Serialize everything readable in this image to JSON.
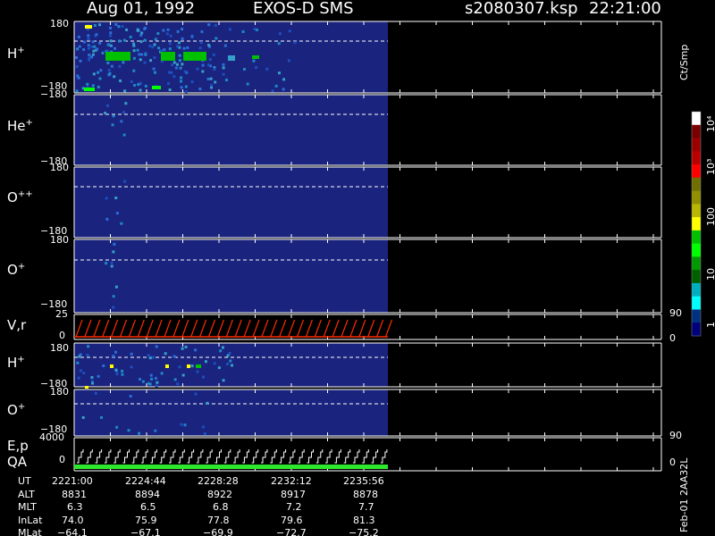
{
  "header": {
    "date": "Aug 01, 1992",
    "instrument": "EXOS-D SMS",
    "file": "s2080307.ksp",
    "time": "22:21:00"
  },
  "panels": [
    {
      "id": "h-plus",
      "species": "H",
      "charge": "+",
      "ymax": "180",
      "ymin": "−180"
    },
    {
      "id": "he-plus",
      "species": "He",
      "charge": "+",
      "ymax": "180",
      "ymin": "−180"
    },
    {
      "id": "o-plus-plus",
      "species": "O",
      "charge": "++",
      "ymax": "180",
      "ymin": "−180"
    },
    {
      "id": "o-plus",
      "species": "O",
      "charge": "+",
      "ymax": "180",
      "ymin": "−180"
    },
    {
      "id": "v-r",
      "species": "V,r",
      "charge": "",
      "ymax": "25",
      "ymin": "0",
      "right_max": "90",
      "right_min": "0"
    },
    {
      "id": "h-plus-2",
      "species": "H",
      "charge": "+",
      "ymax": "180",
      "ymin": "−180"
    },
    {
      "id": "o-plus-2",
      "species": "O",
      "charge": "+",
      "ymax": "180",
      "ymin": "−180"
    },
    {
      "id": "e-p-qa",
      "species": "E,p",
      "species2": "QA",
      "charge": "",
      "ymax": "4000",
      "ymin": "0",
      "right_max": "90",
      "right_min": "0"
    }
  ],
  "colorbar": {
    "title": "Ct/Smp",
    "labels": [
      "10⁴",
      "10³",
      "100",
      "10",
      "1"
    ],
    "colors": [
      "#ffffff",
      "#7a0000",
      "#9a0000",
      "#bb0000",
      "#ff0000",
      "#707000",
      "#909000",
      "#b8b800",
      "#ffff00",
      "#00c000",
      "#00ff00",
      "#009900",
      "#006000",
      "#00b0c0",
      "#00ffff",
      "#003080",
      "#00007a"
    ]
  },
  "footer": {
    "row_labels": [
      "UT",
      "ALT",
      "MLT",
      "InLat",
      "MLat"
    ],
    "columns": [
      [
        "2221:00",
        "8831",
        "6.3",
        "74.0",
        "−64.1"
      ],
      [
        "2224:44",
        "8894",
        "6.5",
        "75.9",
        "−67.1"
      ],
      [
        "2228:28",
        "8922",
        "6.8",
        "77.8",
        "−69.9"
      ],
      [
        "2232:12",
        "8917",
        "7.2",
        "79.6",
        "−72.7"
      ],
      [
        "2235:56",
        "8878",
        "7.7",
        "81.3",
        "−75.2"
      ]
    ],
    "vertical_note": "Feb-01 2AA32L"
  },
  "theme": {
    "plot_bg": "#1a237e",
    "dashed": "#ffffff",
    "vr_trace": "#ff2a00",
    "qa_bar": "#2ee82e"
  }
}
